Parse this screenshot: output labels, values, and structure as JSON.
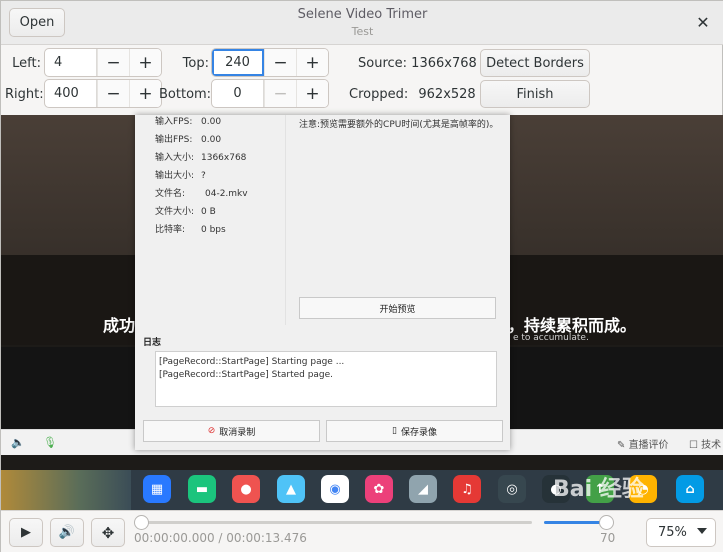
{
  "header": {
    "open_label": "Open",
    "title": "Selene Video Trimer",
    "subtitle": "Test"
  },
  "controls": {
    "left_label": "Left:",
    "left_value": "4",
    "right_label": "Right:",
    "right_value": "400",
    "top_label": "Top:",
    "top_value": "240",
    "bottom_label": "Bottom:",
    "bottom_value": "0",
    "minus": "−",
    "plus": "+",
    "source_label": "Source:",
    "source_value": "1366x768",
    "cropped_label": "Cropped:",
    "cropped_value": "962x528",
    "detect_label": "Detect Borders",
    "finish_label": "Finish"
  },
  "video": {
    "subtitle_left": "成功",
    "subtitle_right": "，持续累积而成。",
    "subtitle_small": "e to accumulate.",
    "bar_right_1": "直播评价",
    "bar_right_2": "技术"
  },
  "dialog": {
    "stats": [
      {
        "k": "输入FPS:",
        "v": "0.00"
      },
      {
        "k": "输出FPS:",
        "v": "0.00"
      },
      {
        "k": "输入大小:",
        "v": "1366x768"
      },
      {
        "k": "输出大小:",
        "v": "?"
      },
      {
        "k": "文件名:",
        "v": "04-2.mkv"
      },
      {
        "k": "文件大小:",
        "v": "0 B"
      },
      {
        "k": "比特率:",
        "v": "0 bps"
      }
    ],
    "note": "注意:预览需要额外的CPU时间(尤其是高帧率的)。",
    "preview_label": "开始预览",
    "log_title": "日志",
    "log_lines": [
      "[PageRecord::StartPage] Starting page ...",
      "[PageRecord::StartPage] Started page."
    ],
    "cancel_label": "取消录制",
    "save_label": "保存录像"
  },
  "watermark": "Bai 经验",
  "player": {
    "time": "00:00:00.000 / 00:00:13.476",
    "position_fraction": 0.0,
    "volume": "70",
    "zoom": "75%"
  }
}
